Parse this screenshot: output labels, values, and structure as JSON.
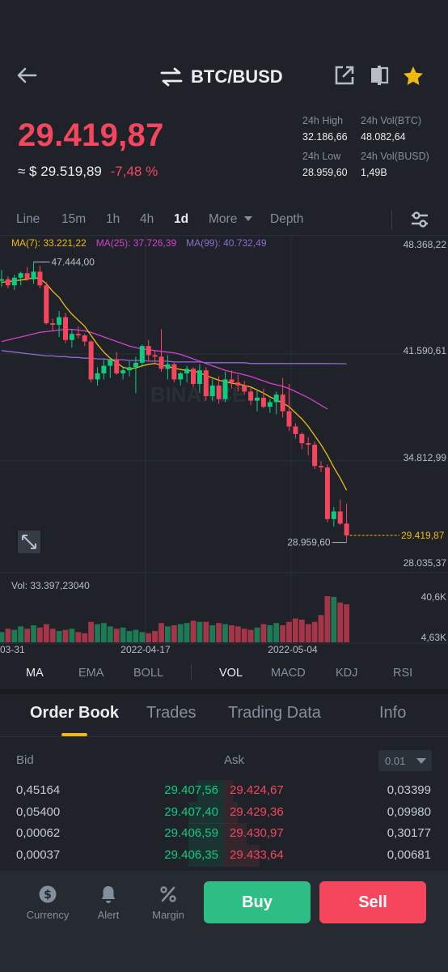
{
  "header": {
    "pair": "BTC/BUSD"
  },
  "price": {
    "last": "29.419,87",
    "usd_prefix": "≈ $",
    "usd": "29.519,89",
    "change": "-7,48 %"
  },
  "stats": {
    "high_label": "24h High",
    "high_value": "32.186,66",
    "vol_btc_label": "24h Vol(BTC)",
    "vol_btc_value": "48.082,64",
    "low_label": "24h Low",
    "low_value": "28.959,60",
    "vol_busd_label": "24h Vol(BUSD)",
    "vol_busd_value": "1,49B"
  },
  "intervals": [
    "Line",
    "15m",
    "1h",
    "4h",
    "1d",
    "More",
    "Depth"
  ],
  "active_interval": "1d",
  "ma_legend": {
    "ma7": "MA(7): 33.221,22",
    "ma25": "MA(25): 37.726,39",
    "ma99": "MA(99): 40.732,49"
  },
  "colors": {
    "up": "#0ecb81",
    "down": "#f6465d",
    "ma7": "#f0b90b",
    "ma25": "#d63fd3",
    "ma99": "#8e6bd6",
    "accent": "#f0b90b"
  },
  "chart_data": {
    "type": "candlestick",
    "price_axis_labels": [
      "48.368,22",
      "41.590,61",
      "34.812,99",
      "28.035,37"
    ],
    "price_ticks": [
      48368.22,
      41590.61,
      34812.99,
      28035.37
    ],
    "current_price_label": "29.419,87",
    "current_price": 29419.87,
    "high_marker": "47.444,00",
    "high_value": 47444.0,
    "low_marker": "28.959,60",
    "low_value": 28959.6,
    "date_labels": [
      "03-31",
      "2022-04-17",
      "2022-05-04"
    ],
    "volume_label": "Vol: 33.397,23040",
    "volume_axis_labels": [
      "40,6K",
      "4,63K"
    ],
    "volume_ticks": [
      40600,
      4630
    ],
    "candles": [
      [
        46200,
        46900,
        45800,
        46300
      ],
      [
        46300,
        46500,
        45700,
        45900
      ],
      [
        45900,
        46600,
        45600,
        46400
      ],
      [
        46400,
        46800,
        45900,
        46700
      ],
      [
        46700,
        47100,
        46200,
        46300
      ],
      [
        46300,
        47444,
        46000,
        46800
      ],
      [
        46800,
        47200,
        45700,
        45900
      ],
      [
        45900,
        46100,
        43300,
        43400
      ],
      [
        43400,
        43700,
        42900,
        43300
      ],
      [
        43300,
        44200,
        42500,
        43800
      ],
      [
        43800,
        44100,
        42100,
        42300
      ],
      [
        42300,
        43000,
        41800,
        42700
      ],
      [
        42700,
        43200,
        42400,
        42600
      ],
      [
        42600,
        42700,
        41900,
        42200
      ],
      [
        42200,
        42300,
        39500,
        39700
      ],
      [
        39700,
        40500,
        39300,
        40100
      ],
      [
        40100,
        41000,
        39700,
        40600
      ],
      [
        40600,
        41100,
        39800,
        41000
      ],
      [
        41000,
        41500,
        40000,
        40100
      ],
      [
        40100,
        40500,
        39700,
        40300
      ],
      [
        40300,
        40900,
        39900,
        40500
      ],
      [
        40500,
        41200,
        38800,
        40800
      ],
      [
        40800,
        42000,
        40500,
        41900
      ],
      [
        41900,
        42300,
        40900,
        41300
      ],
      [
        41300,
        41600,
        40800,
        41200
      ],
      [
        41200,
        43000,
        40200,
        40400
      ],
      [
        40400,
        41300,
        39700,
        40700
      ],
      [
        40700,
        40800,
        39500,
        39700
      ],
      [
        39700,
        40200,
        39300,
        40100
      ],
      [
        40100,
        40600,
        39500,
        40400
      ],
      [
        40400,
        40500,
        39200,
        39400
      ],
      [
        39400,
        40700,
        38800,
        40300
      ],
      [
        40300,
        40500,
        38300,
        38600
      ],
      [
        38600,
        39700,
        38300,
        39300
      ],
      [
        39300,
        39900,
        38100,
        38400
      ],
      [
        38400,
        40200,
        38200,
        39700
      ],
      [
        39700,
        40300,
        39100,
        39500
      ],
      [
        39500,
        40000,
        38900,
        39300
      ],
      [
        39300,
        39600,
        38700,
        38900
      ],
      [
        38900,
        39200,
        38000,
        38300
      ],
      [
        38300,
        39000,
        37600,
        38500
      ],
      [
        38500,
        39100,
        37800,
        37900
      ],
      [
        37900,
        38400,
        37500,
        38200
      ],
      [
        38200,
        38900,
        37400,
        38700
      ],
      [
        38700,
        39800,
        37200,
        37600
      ],
      [
        37600,
        39400,
        36300,
        36600
      ],
      [
        36600,
        36800,
        35800,
        36100
      ],
      [
        36100,
        36200,
        35100,
        35500
      ],
      [
        35500,
        35900,
        34700,
        35400
      ],
      [
        35400,
        35600,
        33800,
        34000
      ],
      [
        34000,
        34300,
        33600,
        33900
      ],
      [
        33900,
        34100,
        30300,
        30500
      ],
      [
        30500,
        31300,
        30000,
        31000
      ],
      [
        31000,
        31800,
        30100,
        30200
      ],
      [
        30200,
        31500,
        28959.6,
        29419.87
      ]
    ],
    "ma7": [
      46100,
      46150,
      46200,
      46250,
      46300,
      46400,
      46350,
      46000,
      45500,
      45100,
      44500,
      44000,
      43600,
      43200,
      42600,
      42000,
      41500,
      41100,
      40800,
      40500,
      40400,
      40450,
      40600,
      40700,
      40750,
      40650,
      40550,
      40450,
      40350,
      40300,
      40250,
      40150,
      39950,
      39800,
      39650,
      39550,
      39450,
      39400,
      39300,
      39200,
      39000,
      38800,
      38550,
      38350,
      38150,
      37900,
      37500,
      37100,
      36600,
      36000,
      35400,
      34700,
      33900,
      33200,
      32400
    ],
    "ma25": [
      42200,
      42300,
      42400,
      42500,
      42600,
      42700,
      42800,
      42850,
      42900,
      42950,
      43000,
      43000,
      42950,
      42900,
      42800,
      42650,
      42500,
      42350,
      42200,
      42050,
      41900,
      41800,
      41700,
      41650,
      41600,
      41550,
      41500,
      41450,
      41350,
      41200,
      41050,
      40900,
      40750,
      40600,
      40450,
      40300,
      40200,
      40100,
      40000,
      39900,
      39750,
      39600,
      39450,
      39350,
      39250,
      39100,
      38900,
      38700,
      38500,
      38250,
      38000,
      37750
    ],
    "ma99": [
      41600,
      41550,
      41500,
      41450,
      41400,
      41350,
      41300,
      41250,
      41250,
      41200,
      41200,
      41150,
      41150,
      41100,
      41100,
      41050,
      41050,
      41000,
      41000,
      41000,
      40950,
      40950,
      40950,
      40900,
      40900,
      40900,
      40900,
      40850,
      40850,
      40850,
      40850,
      40850,
      40800,
      40800,
      40800,
      40800,
      40800,
      40800,
      40800,
      40750,
      40750,
      40750,
      40750,
      40750,
      40750,
      40750,
      40750,
      40750,
      40750,
      40750,
      40750,
      40750,
      40740,
      40735,
      40732.49
    ],
    "volumes": [
      9000,
      12000,
      11000,
      14000,
      12000,
      15000,
      13000,
      16000,
      12000,
      10000,
      11000,
      12000,
      9000,
      8000,
      18000,
      16000,
      17000,
      14000,
      12000,
      13000,
      10000,
      11000,
      9000,
      8000,
      10000,
      17000,
      14000,
      15000,
      16000,
      17000,
      19000,
      18000,
      18000,
      15000,
      17000,
      16000,
      15000,
      14000,
      12000,
      11000,
      13000,
      16000,
      15000,
      17000,
      15000,
      18000,
      21000,
      20000,
      16000,
      18000,
      24000,
      40600,
      40000,
      35000,
      33397
    ]
  },
  "indicators": [
    "MA",
    "EMA",
    "BOLL",
    "VOL",
    "MACD",
    "KDJ",
    "RSI"
  ],
  "orderbook": {
    "tabs": [
      "Order Book",
      "Trades",
      "Trading Data",
      "Info"
    ],
    "bid_label": "Bid",
    "ask_label": "Ask",
    "precision": "0.01",
    "rows": [
      {
        "bid_qty": "0,45164",
        "bid_price": "29.407,56",
        "ask_price": "29.424,67",
        "ask_qty": "0,03399",
        "bid_depth": 0.06,
        "ask_depth": 0.02
      },
      {
        "bid_qty": "0,05400",
        "bid_price": "29.407,40",
        "ask_price": "29.429,36",
        "ask_qty": "0,09980",
        "bid_depth": 0.08,
        "ask_depth": 0.03
      },
      {
        "bid_qty": "0,00062",
        "bid_price": "29.406,59",
        "ask_price": "29.430,97",
        "ask_qty": "0,30177",
        "bid_depth": 0.08,
        "ask_depth": 0.05
      },
      {
        "bid_qty": "0,00037",
        "bid_price": "29.406,35",
        "ask_price": "29.433,64",
        "ask_qty": "0,00681",
        "bid_depth": 0.08,
        "ask_depth": 0.08
      }
    ]
  },
  "bottom": {
    "currency": "Currency",
    "alert": "Alert",
    "margin": "Margin",
    "buy": "Buy",
    "sell": "Sell"
  }
}
